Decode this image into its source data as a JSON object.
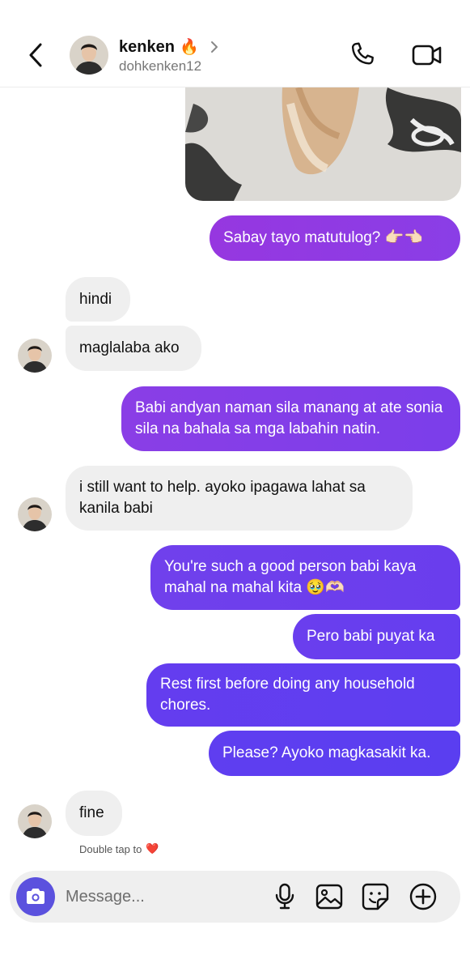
{
  "header": {
    "name": "kenken",
    "name_emoji": "🔥",
    "username": "dohkenken12",
    "icons": [
      "back-arrow-icon",
      "chevron-right-icon",
      "phone-icon",
      "video-camera-icon"
    ]
  },
  "messages": [
    {
      "id": "m1",
      "side": "out",
      "text": "Sabay tayo matutulog? 👉🏻👈🏻"
    },
    {
      "id": "m2",
      "side": "in",
      "text": "hindi"
    },
    {
      "id": "m3",
      "side": "in",
      "text": "maglalaba ako"
    },
    {
      "id": "m4",
      "side": "out",
      "text": "Babi andyan naman sila manang at ate sonia sila na bahala sa mga labahin natin."
    },
    {
      "id": "m5",
      "side": "in",
      "text": "i still want to help. ayoko ipagawa lahat sa kanila babi"
    },
    {
      "id": "m6",
      "side": "out",
      "text": "You're such a good person babi kaya mahal na mahal kita 🥹🫶🏻"
    },
    {
      "id": "m7",
      "side": "out",
      "text": "Pero babi puyat ka"
    },
    {
      "id": "m8",
      "side": "out",
      "text": "Rest first before doing any household chores."
    },
    {
      "id": "m9",
      "side": "out",
      "text": "Please? Ayoko magkasakit ka."
    },
    {
      "id": "m10",
      "side": "in",
      "text": "fine"
    }
  ],
  "hint": {
    "text": "Double tap to",
    "emoji": "❤️"
  },
  "composer": {
    "placeholder": "Message...",
    "icons": [
      "camera-icon",
      "microphone-icon",
      "gallery-icon",
      "sticker-icon",
      "plus-icon"
    ]
  },
  "colors": {
    "out_gradient": [
      "#8f3ee6",
      "#5a3ef0"
    ],
    "in_bubble": "#efefef",
    "camera_button": "#5b51de"
  }
}
